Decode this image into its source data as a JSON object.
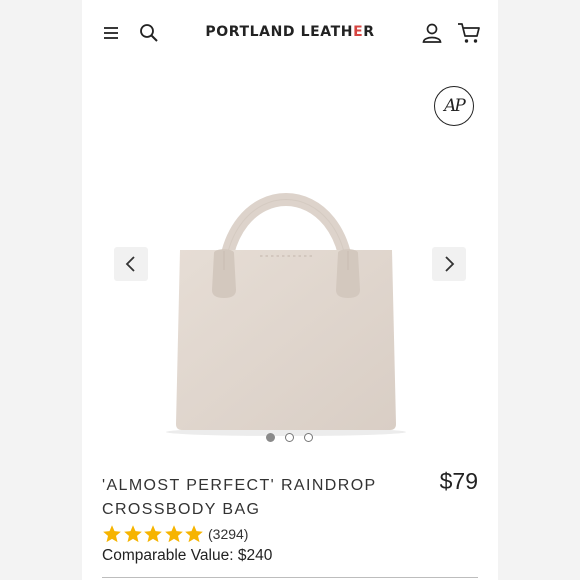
{
  "header": {
    "brand_main": "PORTLAND LEATH",
    "brand_accent": "E",
    "brand_end": "R",
    "icons": {
      "menu": "hamburger-menu-icon",
      "search": "search-icon",
      "account": "user-icon",
      "cart": "shopping-cart-icon"
    }
  },
  "badge": {
    "text": "AP"
  },
  "gallery": {
    "image": "leather-tote-bag",
    "prev_icon": "chevron-left-icon",
    "next_icon": "chevron-right-icon",
    "slide_count": 3,
    "active_slide": 1
  },
  "product": {
    "title_line1": "'ALMOST PERFECT' RAINDROP",
    "title_line2": "CROSSBODY BAG",
    "price": "$79",
    "rating": 5,
    "review_count": "(3294)",
    "comparable": "Comparable Value: $240"
  },
  "colors": {
    "star": "#f6b400",
    "accent": "#d64541",
    "bag": "#e4dbd3"
  }
}
